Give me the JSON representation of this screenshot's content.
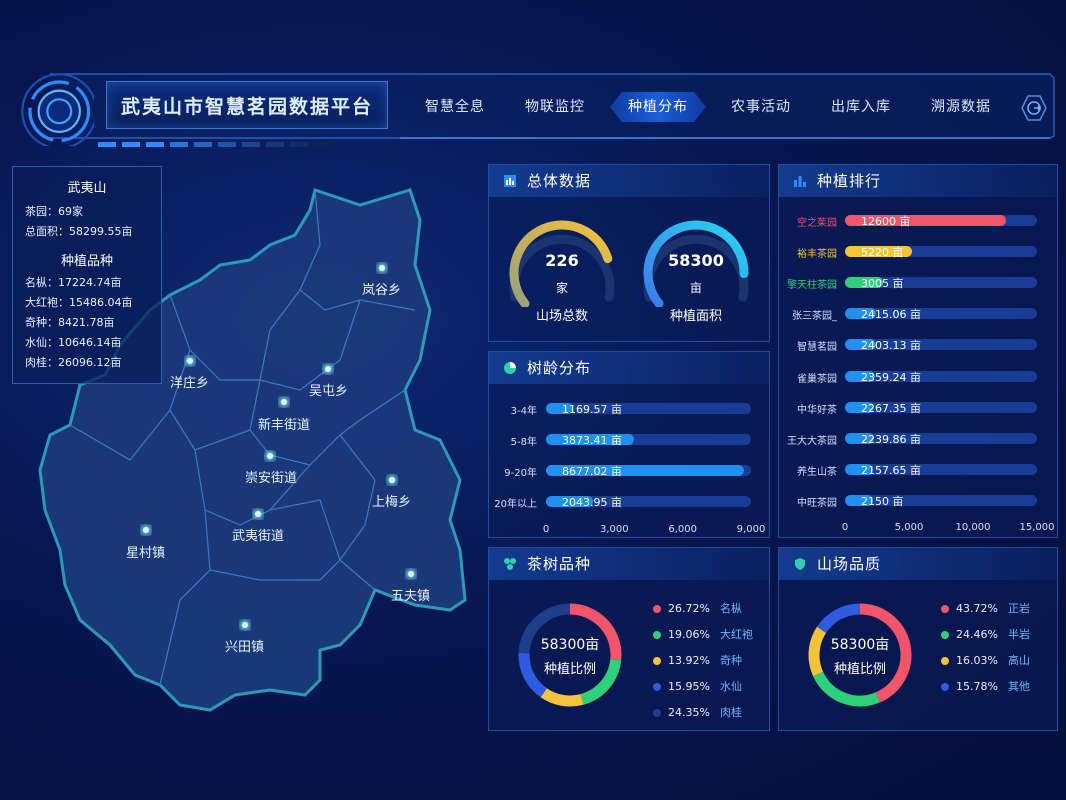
{
  "header": {
    "title": "武夷山市智慧茗园数据平台",
    "nav": [
      "智慧全息",
      "物联监控",
      "种植分布",
      "农事活动",
      "出库入库",
      "溯源数据"
    ],
    "active_nav": "种植分布",
    "exit_icon": "exit-icon"
  },
  "info": {
    "title": "武夷山",
    "tea_gardens": "茶园：69家",
    "total_area": "总面积：58299.55亩",
    "varieties_title": "种植品种",
    "varieties": [
      "名枞：17224.74亩",
      "大红袍：15486.04亩",
      "奇种：8421.78亩",
      "水仙：10646.14亩",
      "肉桂：26096.12亩"
    ]
  },
  "map": {
    "regions": [
      "岚谷乡",
      "洋庄乡",
      "吴屯乡",
      "新丰街道",
      "崇安街道",
      "上梅乡",
      "星村镇",
      "武夷街道",
      "五夫镇",
      "兴田镇"
    ]
  },
  "overview": {
    "title": "总体数据",
    "gauges": [
      {
        "value": "226",
        "unit": "家",
        "caption": "山场总数",
        "fill": 0.78
      },
      {
        "value": "58300",
        "unit": "亩",
        "caption": "种植面积",
        "fill": 0.85
      }
    ]
  },
  "ranking": {
    "title": "种植排行",
    "chart_data": {
      "type": "bar",
      "categories": [
        "空之茱园",
        "裕丰茶园",
        "擎天柱茶园",
        "张三茶园_",
        "智慧茗园",
        "雀巢茶园",
        "中华好茶",
        "王大大茶园",
        "养生山茶",
        "中旺茶园"
      ],
      "values": [
        12600,
        5220,
        3005,
        2415.06,
        2403.13,
        2359.24,
        2267.35,
        2239.86,
        2157.65,
        2150
      ],
      "value_labels": [
        "12600 亩",
        "5220 亩",
        "3005 亩",
        "2415.06 亩",
        "2403.13 亩",
        "2359.24 亩",
        "2267.35 亩",
        "2239.86 亩",
        "2157.65 亩",
        "2150 亩"
      ],
      "xlim": [
        0,
        15000
      ],
      "ticks": [
        "0",
        "5,000",
        "10,000",
        "15,000"
      ],
      "colors": [
        "#f2546b",
        "#f5c33a",
        "#2fd07a",
        "#1f8ff0",
        "#1f8ff0",
        "#1f8ff0",
        "#1f8ff0",
        "#1f8ff0",
        "#1f8ff0",
        "#1f8ff0"
      ],
      "label_colors": [
        "#f2546b",
        "#f5c33a",
        "#2fd07a",
        "#cfe0ff",
        "#cfe0ff",
        "#cfe0ff",
        "#cfe0ff",
        "#cfe0ff",
        "#cfe0ff",
        "#cfe0ff"
      ]
    }
  },
  "age": {
    "title": "树龄分布",
    "chart_data": {
      "type": "bar",
      "categories": [
        "3-4年",
        "5-8年",
        "9-20年",
        "20年以上"
      ],
      "values": [
        1169.57,
        3873.41,
        8677.02,
        2043.95
      ],
      "value_labels": [
        "1169.57 亩",
        "3873.41 亩",
        "8677.02 亩",
        "2043.95 亩"
      ],
      "xlim": [
        0,
        9000
      ],
      "ticks": [
        "0",
        "3,000",
        "6,000",
        "9,000"
      ]
    }
  },
  "variety": {
    "title": "茶树品种",
    "center_value": "58300亩",
    "center_caption": "种植比例",
    "chart_data": {
      "type": "pie",
      "labels": [
        "名枞",
        "大红袍",
        "奇种",
        "水仙",
        "肉桂"
      ],
      "percents": [
        "26.72%",
        "19.06%",
        "13.92%",
        "15.95%",
        "24.35%"
      ],
      "values": [
        26.72,
        19.06,
        13.92,
        15.95,
        24.35
      ],
      "colors": [
        "#f2546b",
        "#2fd07a",
        "#f5c33a",
        "#2f5be0",
        "#1d3f8a"
      ]
    }
  },
  "quality": {
    "title": "山场品质",
    "center_value": "58300亩",
    "center_caption": "种植比例",
    "chart_data": {
      "type": "pie",
      "labels": [
        "正岩",
        "半岩",
        "高山",
        "其他"
      ],
      "percents": [
        "43.72%",
        "24.46%",
        "16.03%",
        "15.78%"
      ],
      "values": [
        43.72,
        24.46,
        16.03,
        15.78
      ],
      "colors": [
        "#f2546b",
        "#2fd07a",
        "#f5c33a",
        "#2f5be0"
      ]
    }
  }
}
